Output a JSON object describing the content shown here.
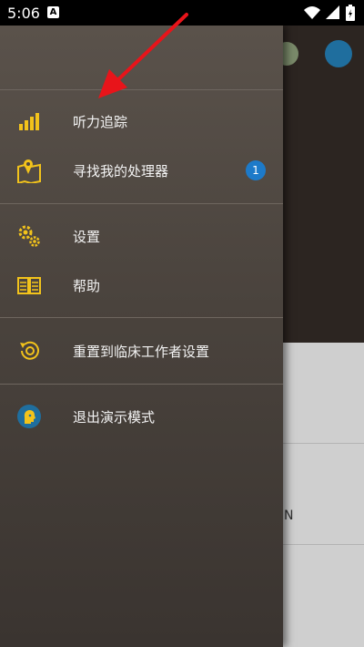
{
  "status": {
    "time": "5:06",
    "notification_glyph": "A"
  },
  "drawer": {
    "items": [
      {
        "label": "听力追踪",
        "icon": "signal-bars-icon"
      },
      {
        "label": "寻找我的处理器",
        "icon": "map-pin-icon",
        "badge": "1"
      },
      {
        "label": "设置",
        "icon": "gears-icon"
      },
      {
        "label": "帮助",
        "icon": "book-icon"
      },
      {
        "label": "重置到临床工作者设置",
        "icon": "reset-icon"
      },
      {
        "label": "退出演示模式",
        "icon": "head-logo-icon"
      }
    ]
  },
  "background_app": {
    "partial_text": "N"
  },
  "colors": {
    "accent_yellow": "#f2c31b",
    "badge_blue": "#1d7ac9",
    "arrow_red": "#e8141a"
  }
}
